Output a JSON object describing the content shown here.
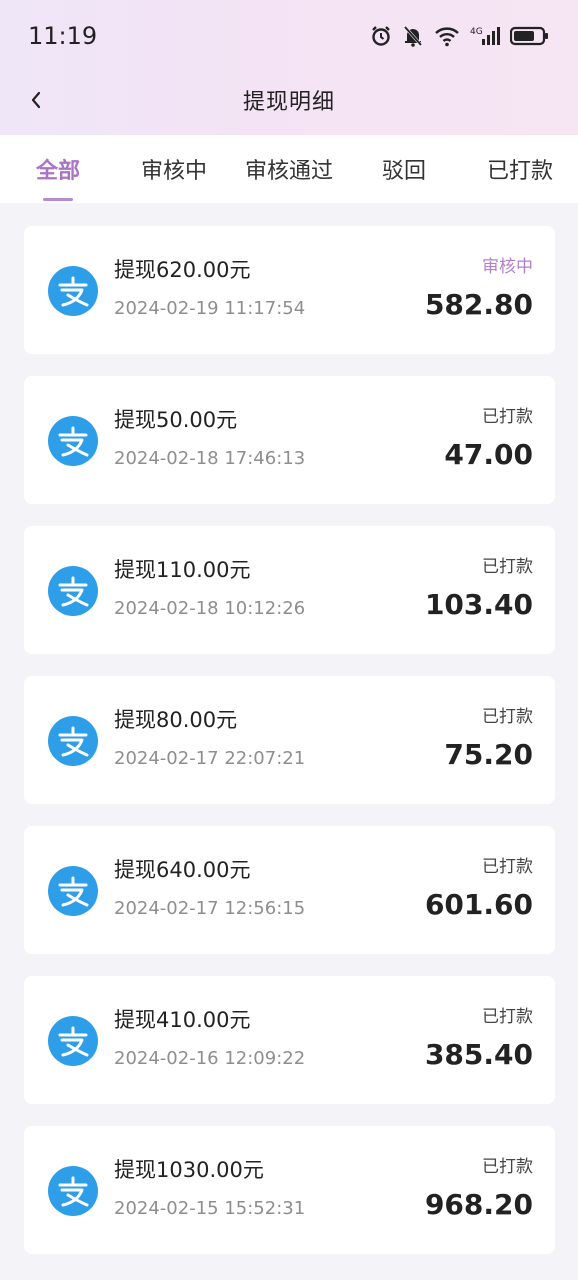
{
  "status_bar": {
    "time": "11:19",
    "network": "4G"
  },
  "nav": {
    "title": "提现明细"
  },
  "tabs": [
    {
      "label": "全部",
      "active": true
    },
    {
      "label": "审核中",
      "active": false
    },
    {
      "label": "审核通过",
      "active": false
    },
    {
      "label": "驳回",
      "active": false
    },
    {
      "label": "已打款",
      "active": false
    }
  ],
  "colors": {
    "accent": "#a974c6",
    "alipay_blue": "#2f9ee8"
  },
  "records": [
    {
      "title": "提现620.00元",
      "date": "2024-02-19 11:17:54",
      "status": "审核中",
      "amount": "582.80",
      "icon": "alipay-icon"
    },
    {
      "title": "提现50.00元",
      "date": "2024-02-18 17:46:13",
      "status": "已打款",
      "amount": "47.00",
      "icon": "alipay-icon"
    },
    {
      "title": "提现110.00元",
      "date": "2024-02-18 10:12:26",
      "status": "已打款",
      "amount": "103.40",
      "icon": "alipay-icon"
    },
    {
      "title": "提现80.00元",
      "date": "2024-02-17 22:07:21",
      "status": "已打款",
      "amount": "75.20",
      "icon": "alipay-icon"
    },
    {
      "title": "提现640.00元",
      "date": "2024-02-17 12:56:15",
      "status": "已打款",
      "amount": "601.60",
      "icon": "alipay-icon"
    },
    {
      "title": "提现410.00元",
      "date": "2024-02-16 12:09:22",
      "status": "已打款",
      "amount": "385.40",
      "icon": "alipay-icon"
    },
    {
      "title": "提现1030.00元",
      "date": "2024-02-15 15:52:31",
      "status": "已打款",
      "amount": "968.20",
      "icon": "alipay-icon"
    }
  ]
}
